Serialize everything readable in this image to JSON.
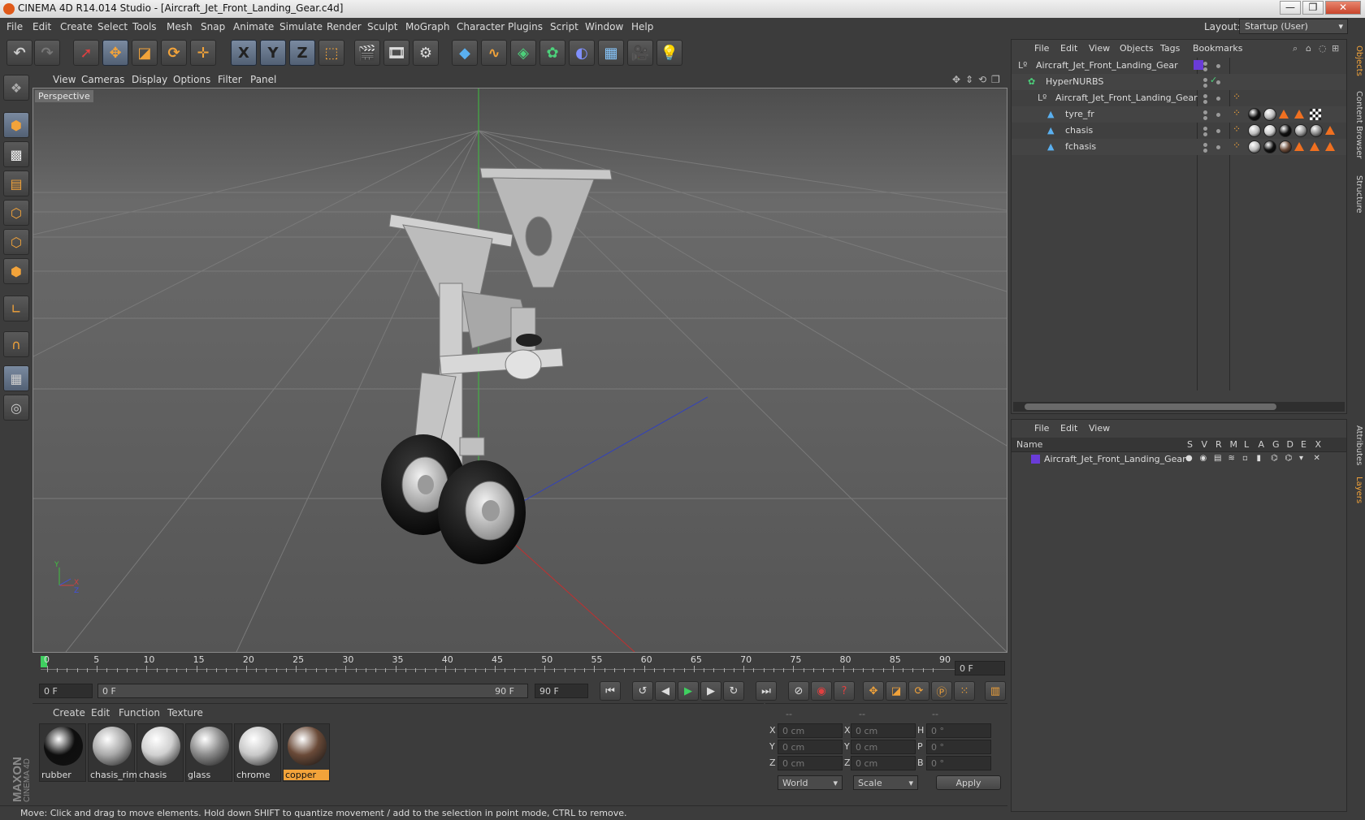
{
  "window": {
    "title": "CINEMA 4D R14.014 Studio - [Aircraft_Jet_Front_Landing_Gear.c4d]",
    "buttons": [
      "—",
      "❐",
      "✕"
    ]
  },
  "menubar": {
    "items": [
      "File",
      "Edit",
      "Create",
      "Select",
      "Tools",
      "Mesh",
      "Snap",
      "Animate",
      "Simulate",
      "Render",
      "Sculpt",
      "MoGraph",
      "Character",
      "Plugins",
      "Script",
      "Window",
      "Help"
    ],
    "layout_label": "Layout:",
    "layout_value": "Startup (User)"
  },
  "toolbar": {
    "axis_labels": [
      "X",
      "Y",
      "Z"
    ]
  },
  "viewport": {
    "menu": [
      "View",
      "Cameras",
      "Display",
      "Options",
      "Filter",
      "Panel"
    ],
    "label": "Perspective",
    "axis_y": "Y",
    "axis_x": "X",
    "axis_z": "Z"
  },
  "timeline": {
    "ticks": [
      "0",
      "5",
      "10",
      "15",
      "20",
      "25",
      "30",
      "35",
      "40",
      "45",
      "50",
      "55",
      "60",
      "65",
      "70",
      "75",
      "80",
      "85",
      "90"
    ],
    "current_frame": "0 F",
    "start_field": "0 F",
    "range_start": "0 F",
    "range_end": "90 F",
    "end_field": "90 F"
  },
  "materials": {
    "menu": [
      "Create",
      "Edit",
      "Function",
      "Texture"
    ],
    "items": [
      {
        "name": "rubber",
        "color": "#0e0e0e"
      },
      {
        "name": "chasis_rim",
        "color": "#a9a9a9"
      },
      {
        "name": "chasis",
        "color": "#d0d0d0"
      },
      {
        "name": "glass",
        "color": "#8a8a8a"
      },
      {
        "name": "chrome",
        "color": "#c8c8c8"
      },
      {
        "name": "copper",
        "color": "#6a4a38"
      }
    ],
    "selected": "copper"
  },
  "coordinates": {
    "headers": [
      "--",
      "--",
      "--"
    ],
    "rows": [
      {
        "a": "X",
        "av": "0 cm",
        "b": "X",
        "bv": "0 cm",
        "c": "H",
        "cv": "0 °"
      },
      {
        "a": "Y",
        "av": "0 cm",
        "b": "Y",
        "bv": "0 cm",
        "c": "P",
        "cv": "0 °"
      },
      {
        "a": "Z",
        "av": "0 cm",
        "b": "Z",
        "bv": "0 cm",
        "c": "B",
        "cv": "0 °"
      }
    ],
    "space": "World",
    "mode": "Scale",
    "apply": "Apply"
  },
  "status": {
    "text": "Move: Click and drag to move elements. Hold down SHIFT to quantize movement / add to the selection in point mode, CTRL to remove."
  },
  "branding": {
    "logo_text": "MAXON CINEMA 4D"
  },
  "objects_manager": {
    "menu": [
      "File",
      "Edit",
      "View",
      "Objects",
      "Tags",
      "Bookmarks"
    ],
    "rows": [
      {
        "name": "Aircraft_Jet_Front_Landing_Gear",
        "indent": 0
      },
      {
        "name": "HyperNURBS",
        "indent": 1
      },
      {
        "name": "Aircraft_Jet_Front_Landing_Gear",
        "indent": 2
      },
      {
        "name": "tyre_fr",
        "indent": 3
      },
      {
        "name": "chasis",
        "indent": 3
      },
      {
        "name": "fchasis",
        "indent": 3
      }
    ]
  },
  "layers_manager": {
    "menu": [
      "File",
      "Edit",
      "View"
    ],
    "columns": [
      "Name",
      "S",
      "V",
      "R",
      "M",
      "L",
      "A",
      "G",
      "D",
      "E",
      "X"
    ],
    "rows": [
      {
        "name": "Aircraft_Jet_Front_Landing_Gear",
        "color": "#6a3cd8"
      }
    ]
  },
  "side_tabs": [
    "Objects",
    "Content Browser",
    "Structure",
    "Attributes",
    "Layers"
  ],
  "colors": {
    "accent": "#f2a33a",
    "selected_material": "#f2a33a",
    "layer_color": "#6a3cd8"
  }
}
